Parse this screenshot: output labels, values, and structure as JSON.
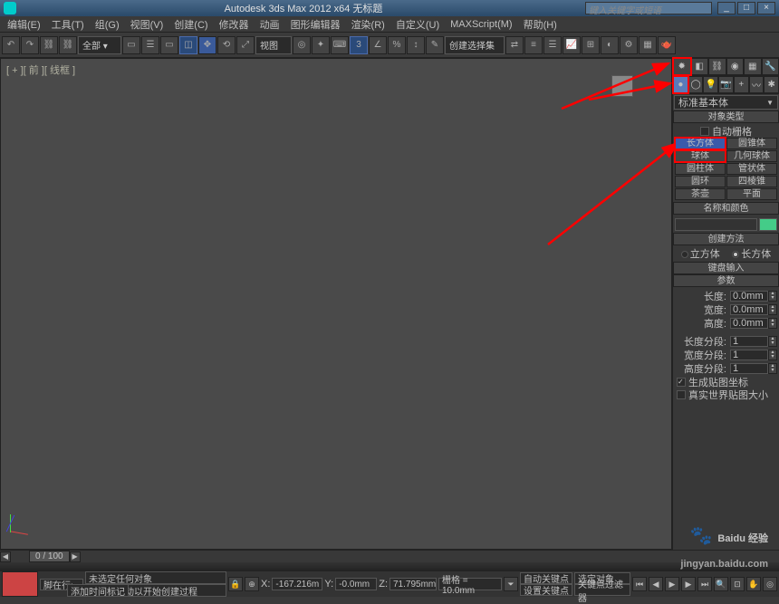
{
  "titlebar": {
    "title": "Autodesk 3ds Max 2012 x64   无标题",
    "search_placeholder": "键入关键字或短语",
    "min": "_",
    "max": "□",
    "close": "×"
  },
  "menu": [
    "编辑(E)",
    "工具(T)",
    "组(G)",
    "视图(V)",
    "创建(C)",
    "修改器",
    "动画",
    "图形编辑器",
    "渲染(R)",
    "自定义(U)",
    "MAXScript(M)",
    "帮助(H)"
  ],
  "toolbar": {
    "combo1": "全部 ▾",
    "combo2": "视图",
    "combo3": "创建选择集"
  },
  "viewport": {
    "label": "[ + ][ 前 ][ 线框 ]"
  },
  "cmdpanel": {
    "dropdown": "标准基本体",
    "rollouts": {
      "obj_type": "对象类型",
      "auto_grid": "自动栅格",
      "name_color": "名称和颜色",
      "create_method": "创建方法",
      "kbd_input": "键盘输入",
      "params": "参数"
    },
    "primitives": [
      [
        "长方体",
        "圆锥体"
      ],
      [
        "球体",
        "几何球体"
      ],
      [
        "圆柱体",
        "管状体"
      ],
      [
        "圆环",
        "四棱锥"
      ],
      [
        "茶壶",
        "平面"
      ]
    ],
    "create_opts": {
      "cube": "立方体",
      "box": "长方体"
    },
    "params": {
      "length_lbl": "长度:",
      "length_val": "0.0mm",
      "width_lbl": "宽度:",
      "width_val": "0.0mm",
      "height_lbl": "高度:",
      "height_val": "0.0mm",
      "lseg_lbl": "长度分段:",
      "lseg_val": "1",
      "wseg_lbl": "宽度分段:",
      "wseg_val": "1",
      "hseg_lbl": "高度分段:",
      "hseg_val": "1",
      "gen_map": "生成贴图坐标",
      "real_world": "真实世界贴图大小"
    }
  },
  "time": {
    "frame": "0 / 100"
  },
  "status": {
    "prompt1": "未选定任何对象",
    "prompt2": "单击并拖动以开始创建过程",
    "x_lbl": "X:",
    "x": "-167.216m",
    "y_lbl": "Y:",
    "y": "-0.0mm",
    "z_lbl": "Z:",
    "z": "71.795mm",
    "grid": "栅格 = 10.0mm",
    "auto_key": "自动关键点",
    "sel_obj": "选定对象",
    "set_key": "设置关键点",
    "key_filter": "关键点过滤器",
    "add_marker": "添加时间标记",
    "script_btn": "脚在行:"
  },
  "watermark": {
    "brand": "Baidu 经验",
    "url": "jingyan.baidu.com"
  }
}
